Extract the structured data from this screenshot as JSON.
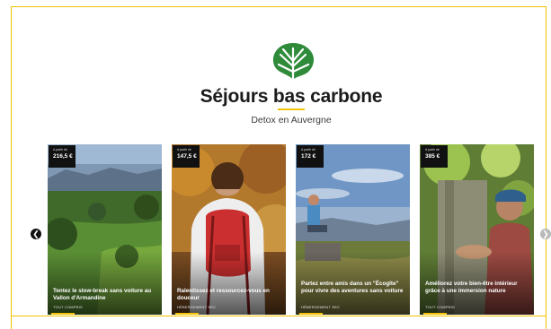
{
  "header": {
    "logo_icon": "palm-leaf-icon",
    "title": "Séjours bas carbone",
    "subtitle": "Detox en Auvergne",
    "accent_color": "#f2c200",
    "logo_color": "#2f8b3a"
  },
  "carousel": {
    "prev_icon": "arrow-left-icon",
    "next_icon": "arrow-right-icon",
    "cards": [
      {
        "price_from": "A partir de",
        "price": "216,5 €",
        "caption": "Tentez le slow-break sans voiture au Vallon d'Armandine",
        "tag": "TOUT COMPRIS"
      },
      {
        "price_from": "A partir de",
        "price": "147,5 €",
        "caption": "Ralentissez et ressourcez-vous en douceur",
        "tag": "HÉBERGEMENT SEC"
      },
      {
        "price_from": "A partir de",
        "price": "172 €",
        "caption": "Partez entre amis dans un \"Écogîte\" pour vivre des aventures sans voiture",
        "tag": "HÉBERGEMENT SEC"
      },
      {
        "price_from": "A partir de",
        "price": "385 €",
        "caption": "Améliorez votre bien-être intérieur grâce à une immersion nature",
        "tag": "TOUT COMPRIS"
      }
    ]
  }
}
